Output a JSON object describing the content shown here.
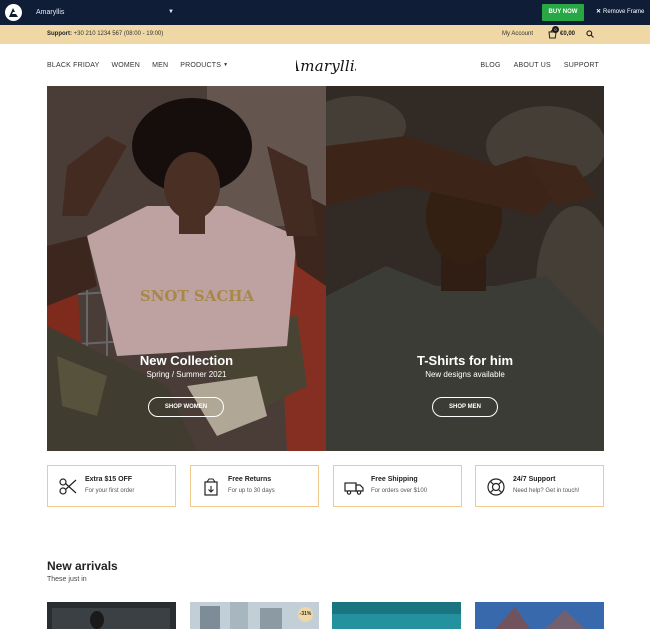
{
  "frame_bar": {
    "theme_name": "Amaryllis",
    "buy_label": "BUY NOW",
    "remove_label": "Remove Frame",
    "buy_color": "#28a745",
    "background": "#0f1d36"
  },
  "support_bar": {
    "label": "Support:",
    "phone": "+30 210 1234 567 (08:00 - 19:00)",
    "account_label": "My Account",
    "cart_count": "0",
    "cart_total": "€0,00",
    "background": "#efd7a6"
  },
  "nav": {
    "left": [
      "BLACK FRIDAY",
      "WOMEN",
      "MEN",
      "PRODUCTS"
    ],
    "right": [
      "BLOG",
      "ABOUT US",
      "SUPPORT"
    ],
    "brand": "Amaryllis"
  },
  "hero": {
    "women": {
      "title": "New Collection",
      "subtitle": "Spring / Summer 2021",
      "button": "SHOP WOMEN",
      "shirt_print": "SNOT SACHA"
    },
    "men": {
      "title": "T-Shirts for him",
      "subtitle": "New designs available",
      "button": "SHOP MEN"
    }
  },
  "features": [
    {
      "icon": "scissors-icon",
      "title": "Extra $15 OFF",
      "subtitle": "For your first order"
    },
    {
      "icon": "return-box-icon",
      "title": "Free Returns",
      "subtitle": "For up to 30 days"
    },
    {
      "icon": "truck-icon",
      "title": "Free Shipping",
      "subtitle": "For orders over $100"
    },
    {
      "icon": "lifebuoy-icon",
      "title": "24/7 Support",
      "subtitle": "Need help? Get in touch!"
    }
  ],
  "arrivals": {
    "title": "New arrivals",
    "subtitle": "These just in",
    "products": [
      {
        "badge": ""
      },
      {
        "badge": "-31%"
      },
      {
        "badge": ""
      },
      {
        "badge": ""
      }
    ]
  },
  "colors": {
    "accent_border": "#f0c98f",
    "text_dark": "#222222"
  }
}
